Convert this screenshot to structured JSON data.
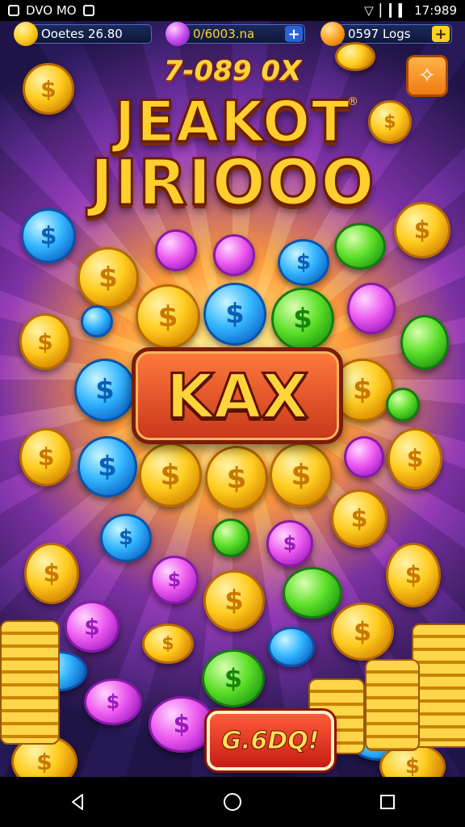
{
  "status_bar": {
    "left_text": "DVO MO",
    "right_text": "17:989"
  },
  "currency": {
    "coins": "Ooetes 26.80",
    "gems": "0/6003.na",
    "hearts": "0597 Logs",
    "plus": "+"
  },
  "game": {
    "top_text": "7-089 0X",
    "title_line1": "JEAKOT",
    "title_line2": "JIRIOOO",
    "registered_mark": "®",
    "center_text": "KAX",
    "coin_symbol": "$",
    "bottom_button": "G.6DQ!"
  },
  "colors": {
    "gold": "#ffcc1f",
    "blue": "#34b6ff",
    "green": "#5ee02a",
    "pink": "#ee5cf0",
    "button_red": "#c51d14"
  },
  "icons": {
    "settings": "settings-icon",
    "back": "back-icon",
    "home": "home-icon",
    "recents": "recents-icon"
  }
}
